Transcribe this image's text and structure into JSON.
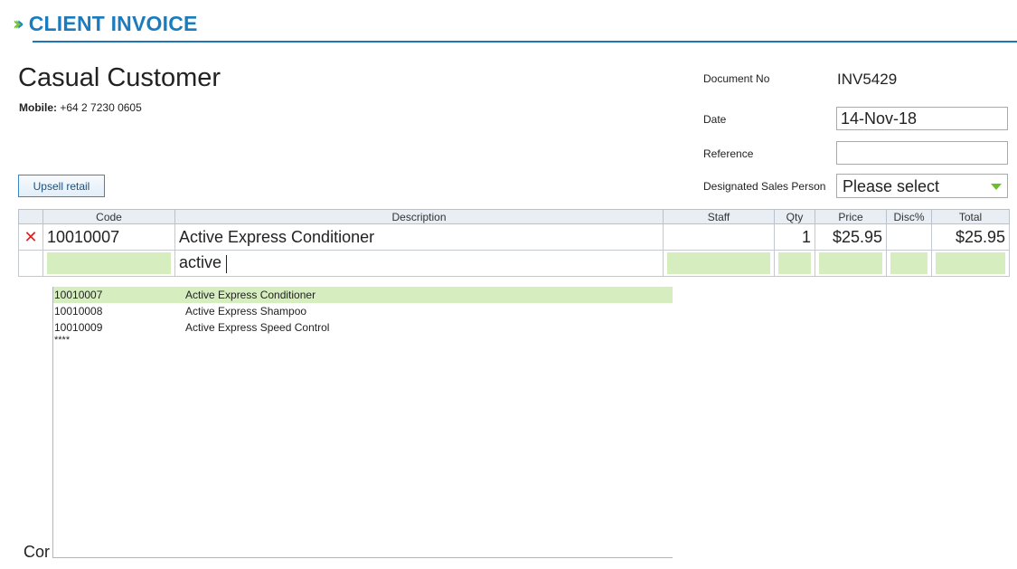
{
  "header": {
    "title": "CLIENT INVOICE"
  },
  "customer": {
    "name": "Casual Customer",
    "mobile_label": "Mobile:",
    "mobile": "+64 2 7230 0605"
  },
  "upsell_button": "Upsell retail",
  "meta": {
    "document_no_label": "Document No",
    "document_no": "INV5429",
    "date_label": "Date",
    "date": "14-Nov-18",
    "reference_label": "Reference",
    "reference": "",
    "sales_person_label": "Designated Sales Person",
    "sales_person": "Please select"
  },
  "table": {
    "headers": [
      "",
      "Code",
      "Description",
      "Staff",
      "Qty",
      "Price",
      "Disc%",
      "Total"
    ],
    "row": {
      "code": "10010007",
      "description": "Active Express Conditioner",
      "staff": "",
      "qty": "1",
      "price": "$25.95",
      "disc": "",
      "total": "$25.95"
    },
    "input_row": {
      "description": "active"
    }
  },
  "dropdown": {
    "items": [
      {
        "code": "10010007",
        "description": "Active Express Conditioner"
      },
      {
        "code": "10010008",
        "description": "Active Express Shampoo"
      },
      {
        "code": "10010009",
        "description": "Active Express Speed Control"
      }
    ],
    "more": "****"
  },
  "footer": {
    "partial_text": "Cor"
  },
  "colors": {
    "accent": "#1a7cbf",
    "chevron_green": "#7cc242",
    "highlight": "#d6edc0",
    "delete": "#e02020"
  },
  "icons": {
    "delete": "cross-icon",
    "header": "double-chevron-icon",
    "select": "triangle-down-icon"
  }
}
